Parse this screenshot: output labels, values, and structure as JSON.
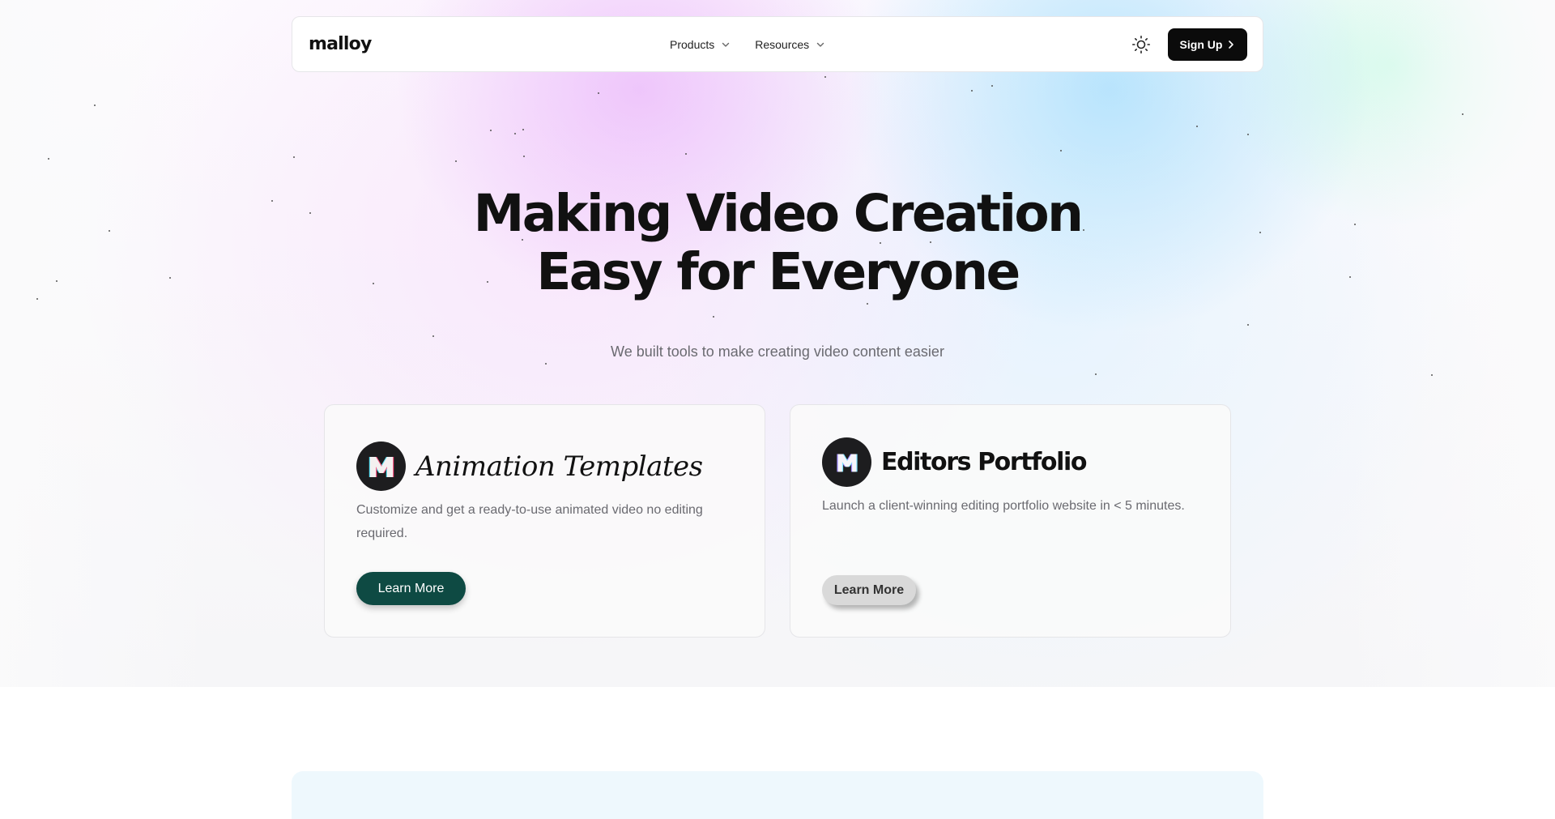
{
  "nav": {
    "logo": "malloy",
    "links": [
      {
        "label": "Products",
        "icon": "chevron-down-icon"
      },
      {
        "label": "Resources",
        "icon": "chevron-down-icon"
      }
    ],
    "theme_toggle_icon": "sun-icon",
    "signup_label": "Sign Up",
    "signup_icon": "chevron-right-icon"
  },
  "hero": {
    "headline_line1": "Making Video Creation",
    "headline_line2": "Easy for Everyone",
    "subtitle": "We built tools to make creating video content easier"
  },
  "cards": [
    {
      "title": "Animation Templates",
      "icon": "m-logo-icon",
      "description": "Customize and get a ready-to-use animated video no editing required.",
      "button_label": "Learn More",
      "button_color": "#0e4a43"
    },
    {
      "title": "Editors Portfolio",
      "icon": "m-logo-icon",
      "description": "Launch a client-winning editing portfolio website in < 5 minutes.",
      "button_label": "Learn More",
      "button_color": "#d9d9d9"
    }
  ],
  "colors": {
    "accent_dark": "#0b0b0b",
    "accent_green": "#0e4a43",
    "gradient_pink": "#e8b0fa",
    "gradient_blue": "#a0dcfc",
    "gradient_mint": "#b4fadc"
  }
}
